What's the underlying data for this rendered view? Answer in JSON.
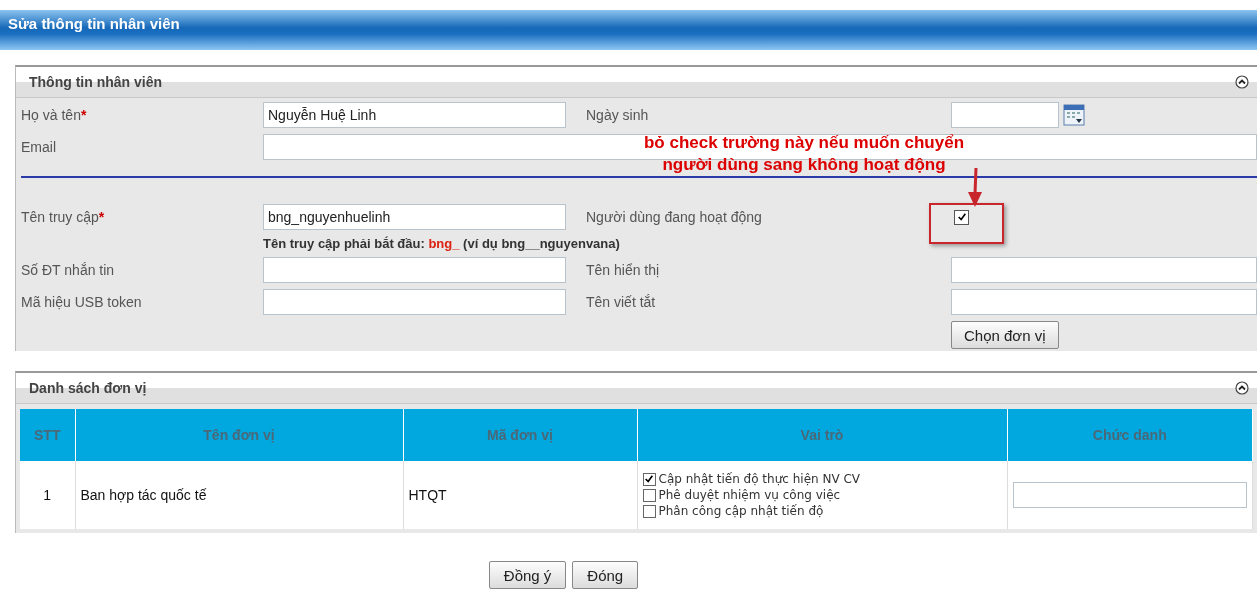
{
  "window": {
    "title": "Sửa thông tin nhân viên"
  },
  "employee_panel": {
    "title": "Thông tin nhân viên",
    "full_name": {
      "label": "Họ và tên",
      "required_mark": "*",
      "value": "Nguyễn Huệ Linh"
    },
    "birth_date": {
      "label": "Ngày sinh"
    },
    "email": {
      "label": "Email"
    },
    "username": {
      "label": "Tên truy cập",
      "required_mark": "*",
      "value": "bng_nguyenhuelinh"
    },
    "active": {
      "label": "Người dùng đang hoạt động",
      "checked": true
    },
    "username_hint": {
      "prefix": "Tên truy cập phải bắt đầu:",
      "highlight": "bng_",
      "suffix": "(ví dụ bng__nguyenvana)"
    },
    "sms_phone": {
      "label": "Số ĐT nhắn tin"
    },
    "display_name": {
      "label": "Tên hiển thị"
    },
    "usb_token": {
      "label": "Mã hiệu USB token"
    },
    "short_name": {
      "label": "Tên viết tắt"
    },
    "choose_unit_button": "Chọn đơn vị"
  },
  "annotation": {
    "lines": [
      "bỏ check trường này nếu muốn chuyển",
      "người dùng sang không hoạt động"
    ]
  },
  "units_panel": {
    "title": "Danh sách đơn vị",
    "columns": [
      "STT",
      "Tên đơn vị",
      "Mã đơn vị",
      "Vai trò",
      "Chức danh"
    ],
    "rows": [
      {
        "stt": "1",
        "unit_name": "Ban hợp tác quốc tế",
        "unit_code": "HTQT",
        "roles": [
          {
            "label": "Cập nhật tiến độ thực hiện NV CV",
            "checked": true
          },
          {
            "label": "Phê duyệt nhiệm vụ công việc",
            "checked": false
          },
          {
            "label": "Phân công cập nhật tiến độ",
            "checked": false
          }
        ]
      }
    ]
  },
  "buttons": [
    "Đồng ý",
    "Đóng"
  ]
}
